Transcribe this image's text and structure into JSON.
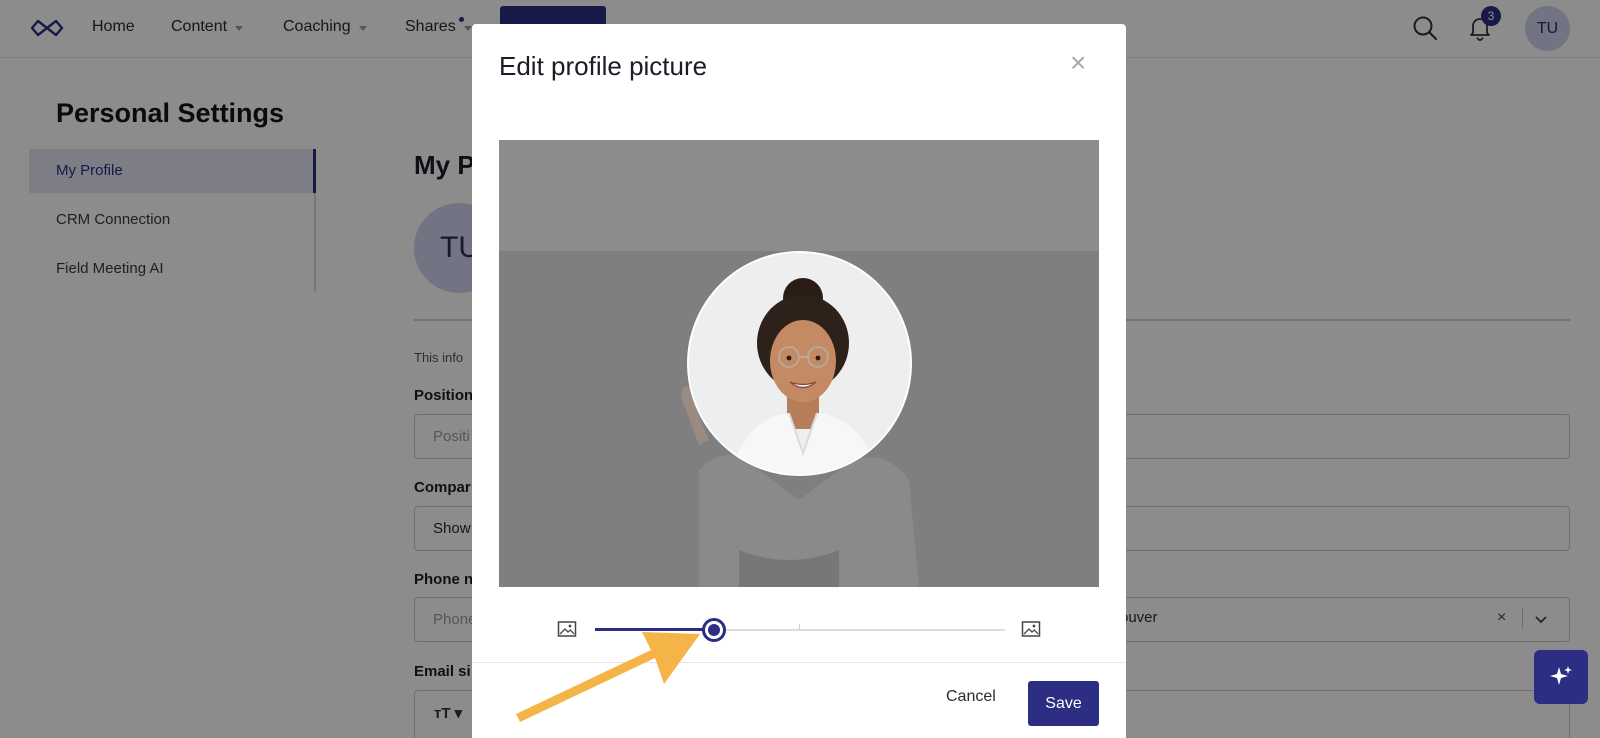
{
  "nav": {
    "items": [
      {
        "label": "Home",
        "dropdown": false
      },
      {
        "label": "Content",
        "dropdown": true
      },
      {
        "label": "Coaching",
        "dropdown": true
      },
      {
        "label": "Shares",
        "dropdown": true
      }
    ],
    "notification_count": "3",
    "avatar_initials": "TU"
  },
  "settings": {
    "title": "Personal Settings",
    "menu": [
      "My Profile",
      "CRM Connection",
      "Field Meeting AI"
    ],
    "active_index": 0
  },
  "profile": {
    "heading_partial": "My P",
    "avatar_partial": "TU",
    "info_partial": "This info",
    "fields": [
      {
        "label_partial": "Position",
        "value_partial": "Positi"
      },
      {
        "label_partial": "Compar",
        "value_partial": "Show"
      },
      {
        "label_partial": "Phone n",
        "value_partial": "Phone"
      },
      {
        "label_partial": "Email si",
        "value_partial": ""
      }
    ],
    "timezone_partial": "ouver",
    "clear_symbol": "×"
  },
  "modal": {
    "title": "Edit profile picture",
    "close_symbol": "×",
    "zoom_value": 0.29,
    "cancel_label": "Cancel",
    "save_label": "Save"
  },
  "colors": {
    "brand": "#2b2e83",
    "annotation_arrow": "#f5b447"
  }
}
